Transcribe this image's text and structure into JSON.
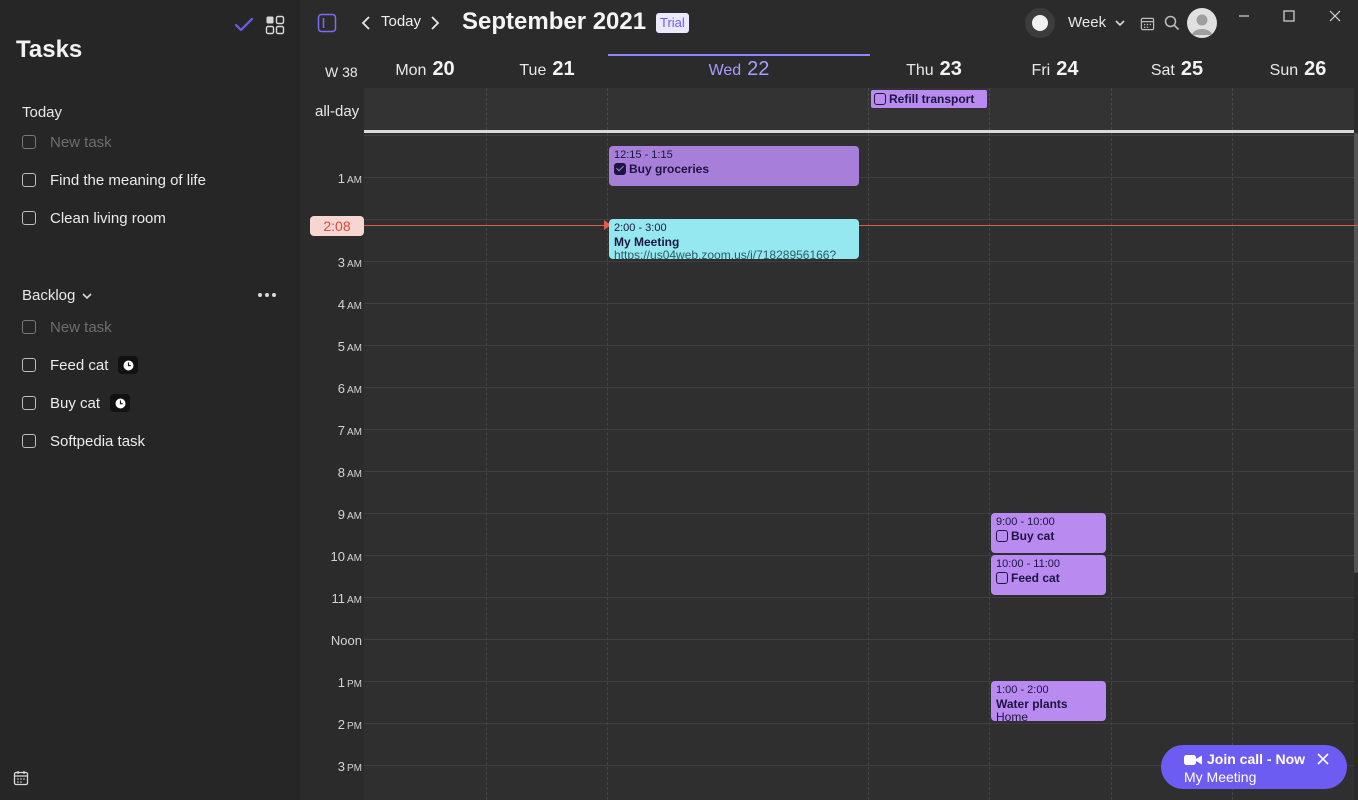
{
  "sidebar": {
    "title": "Tasks",
    "today_section": {
      "label": "Today",
      "new_task_placeholder": "New task",
      "tasks": [
        "Find the meaning of life",
        "Clean living room"
      ]
    },
    "backlog_section": {
      "label": "Backlog",
      "new_task_placeholder": "New task",
      "tasks": [
        "Feed cat",
        "Buy cat",
        "Softpedia task"
      ]
    }
  },
  "topbar": {
    "today_label": "Today",
    "month_title": "September 2021",
    "trial_badge": "Trial",
    "view_label": "Week"
  },
  "week": {
    "week_label": "W 38",
    "allday_label": "all-day",
    "days": [
      {
        "name": "Mon",
        "num": "20"
      },
      {
        "name": "Tue",
        "num": "21"
      },
      {
        "name": "Wed",
        "num": "22"
      },
      {
        "name": "Thu",
        "num": "23"
      },
      {
        "name": "Fri",
        "num": "24"
      },
      {
        "name": "Sat",
        "num": "25"
      },
      {
        "name": "Sun",
        "num": "26"
      }
    ],
    "today_day": "Wed 22"
  },
  "time_labels": [
    {
      "h": "1",
      "ampm": "AM"
    },
    {
      "h": "2:08",
      "ampm": ""
    },
    {
      "h": "3",
      "ampm": "AM"
    },
    {
      "h": "4",
      "ampm": "AM"
    },
    {
      "h": "5",
      "ampm": "AM"
    },
    {
      "h": "6",
      "ampm": "AM"
    },
    {
      "h": "7",
      "ampm": "AM"
    },
    {
      "h": "8",
      "ampm": "AM"
    },
    {
      "h": "9",
      "ampm": "AM"
    },
    {
      "h": "10",
      "ampm": "AM"
    },
    {
      "h": "11",
      "ampm": "AM"
    },
    {
      "h": "Noon",
      "ampm": ""
    },
    {
      "h": "1",
      "ampm": "PM"
    },
    {
      "h": "2",
      "ampm": "PM"
    },
    {
      "h": "3",
      "ampm": "PM"
    }
  ],
  "now_time": "2:08",
  "allday_event": {
    "title": "Refill transport",
    "day": "Thu 23"
  },
  "events": {
    "groceries": {
      "time": "12:15 - 1:15",
      "title": "Buy groceries",
      "day": "Wed 22",
      "color": "#a77fd8"
    },
    "meeting": {
      "time": "2:00 - 3:00",
      "title": "My Meeting",
      "link": "https://us04web.zoom.us/j/71828956166?",
      "day": "Wed 22",
      "color": "#95e8f0"
    },
    "buycat": {
      "time": "9:00 - 10:00",
      "title": "Buy cat",
      "day": "Fri 24",
      "color": "#b98bf0"
    },
    "feedcat": {
      "time": "10:00 - 11:00",
      "title": "Feed cat",
      "day": "Fri 24",
      "color": "#b98bf0"
    },
    "plants": {
      "time": "1:00 - 2:00",
      "title": "Water plants",
      "location": "Home",
      "day": "Fri 24",
      "color": "#b98bf0"
    }
  },
  "join_call": {
    "title": "Join call - Now",
    "meeting": "My Meeting"
  },
  "colors": {
    "accent": "#6d5cf2",
    "now_line": "#e25c4f",
    "today_header": "#a89cff"
  }
}
